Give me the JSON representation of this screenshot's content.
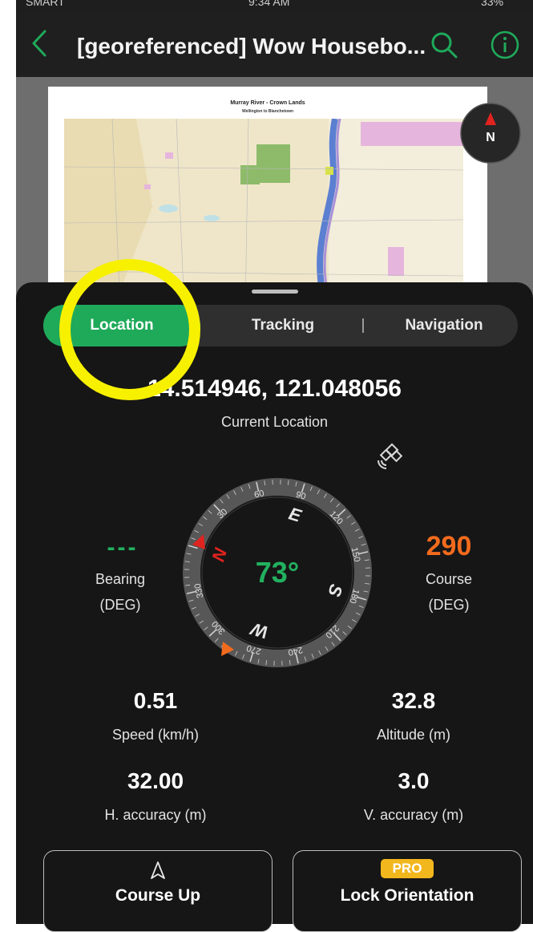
{
  "status_bar": {
    "carrier": "SMART",
    "time": "9:34 AM",
    "battery": "33%"
  },
  "header": {
    "title": "[georeferenced] Wow Housebo...",
    "back_icon": "chevron-left-icon",
    "search_icon": "search-icon",
    "info_icon": "info-icon",
    "accent_color": "#1faa5a"
  },
  "document": {
    "map_title": "Murray River - Crown Lands",
    "map_subtitle": "Wellington to Blanchetown",
    "compass_label": "N"
  },
  "tabs": [
    {
      "label": "Location",
      "active": true
    },
    {
      "label": "Tracking",
      "active": false
    },
    {
      "label": "Navigation",
      "active": false
    }
  ],
  "location": {
    "coordinates": "14.514946, 121.048056",
    "caption": "Current Location"
  },
  "bearing": {
    "value": "---",
    "label": "Bearing",
    "unit": "(DEG)"
  },
  "course": {
    "value": "290",
    "label": "Course",
    "unit": "(DEG)"
  },
  "compass": {
    "heading_text": "73°",
    "heading_degrees": 73,
    "cardinals": [
      "N",
      "E",
      "S",
      "W"
    ],
    "ticks": [
      "30",
      "60",
      "90",
      "120",
      "150",
      "180",
      "210",
      "240",
      "270",
      "300",
      "330"
    ]
  },
  "stats": {
    "speed": {
      "value": "0.51",
      "label": "Speed (km/h)"
    },
    "altitude": {
      "value": "32.8",
      "label": "Altitude (m)"
    },
    "h_accuracy": {
      "value": "32.00",
      "label": "H. accuracy (m)"
    },
    "v_accuracy": {
      "value": "3.0",
      "label": "V. accuracy (m)"
    }
  },
  "buttons": {
    "course_up": {
      "label": "Course Up",
      "icon": "navigation-arrow-icon"
    },
    "lock_orientation": {
      "label": "Lock Orientation",
      "badge": "PRO"
    }
  },
  "colors": {
    "green": "#1faa5a",
    "orange": "#f26b1d",
    "red": "#e0231f",
    "pro_badge": "#f2b71d",
    "highlight": "#f7f100"
  }
}
